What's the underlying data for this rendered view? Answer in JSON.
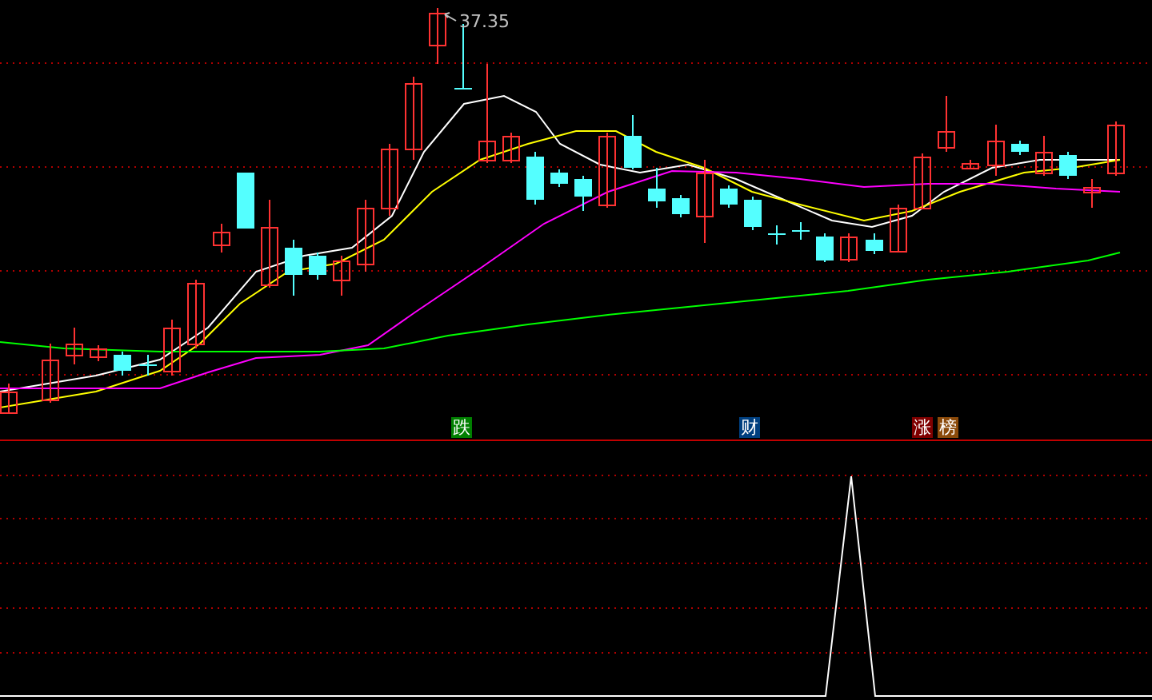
{
  "price_chart": {
    "high_label": "37.35"
  },
  "signals": [
    {
      "text": "跌",
      "color": "#007f00"
    },
    {
      "text": "财",
      "color": "#003f7f"
    },
    {
      "text": "涨",
      "color": "#7f0000"
    },
    {
      "text": "榜",
      "color": "#8b4a0a"
    }
  ],
  "indicator_panel": {
    "kind": "spike"
  }
}
